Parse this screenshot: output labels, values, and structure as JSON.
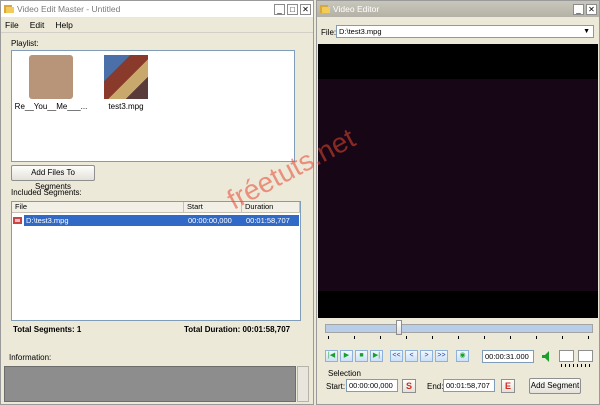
{
  "left_window": {
    "title": "Video Edit Master - Untitled",
    "menu": [
      "File",
      "Edit",
      "Help"
    ],
    "playlist_label": "Playlist:",
    "playlist": [
      {
        "label": "Re__You__Me___...",
        "thumb_color": "#b89478"
      },
      {
        "label": "test3.mpg",
        "thumb_color": "#7d5a55"
      }
    ],
    "add_files_button": "Add Files To Segments",
    "segments_label": "Included Segments:",
    "columns": [
      "File",
      "Start",
      "Duration"
    ],
    "segments": [
      {
        "file": "D:\\test3.mpg",
        "start": "00:00:00,000",
        "duration": "00:01:58,707"
      }
    ],
    "total_segments": "Total Segments: 1",
    "total_duration": "Total Duration: 00:01:58,707",
    "information_label": "Information:"
  },
  "right_window": {
    "title": "Video Editor",
    "file_label": "File:",
    "file_value": "D:\\test3.mpg",
    "seek_position": 0.27,
    "controls": [
      "first",
      "play",
      "stop",
      "last",
      "<<",
      "<",
      ">",
      ">>",
      "preview"
    ],
    "time_value": "00:00:31.000",
    "selection_label": "Selection",
    "start_label": "Start:",
    "start_value": "00:00:00,000",
    "start_btn": "S",
    "end_label": "End:",
    "end_value": "00:01:58,707",
    "end_btn": "E",
    "add_segment_button": "Add Segment"
  },
  "window_buttons": {
    "minimize": "_",
    "maximize": "□",
    "close": "✕"
  },
  "watermark": "fréetuts.net",
  "colors": {
    "selection": "#3169c6",
    "video_bg": "#170716",
    "accent_red": "#d32b1c"
  }
}
